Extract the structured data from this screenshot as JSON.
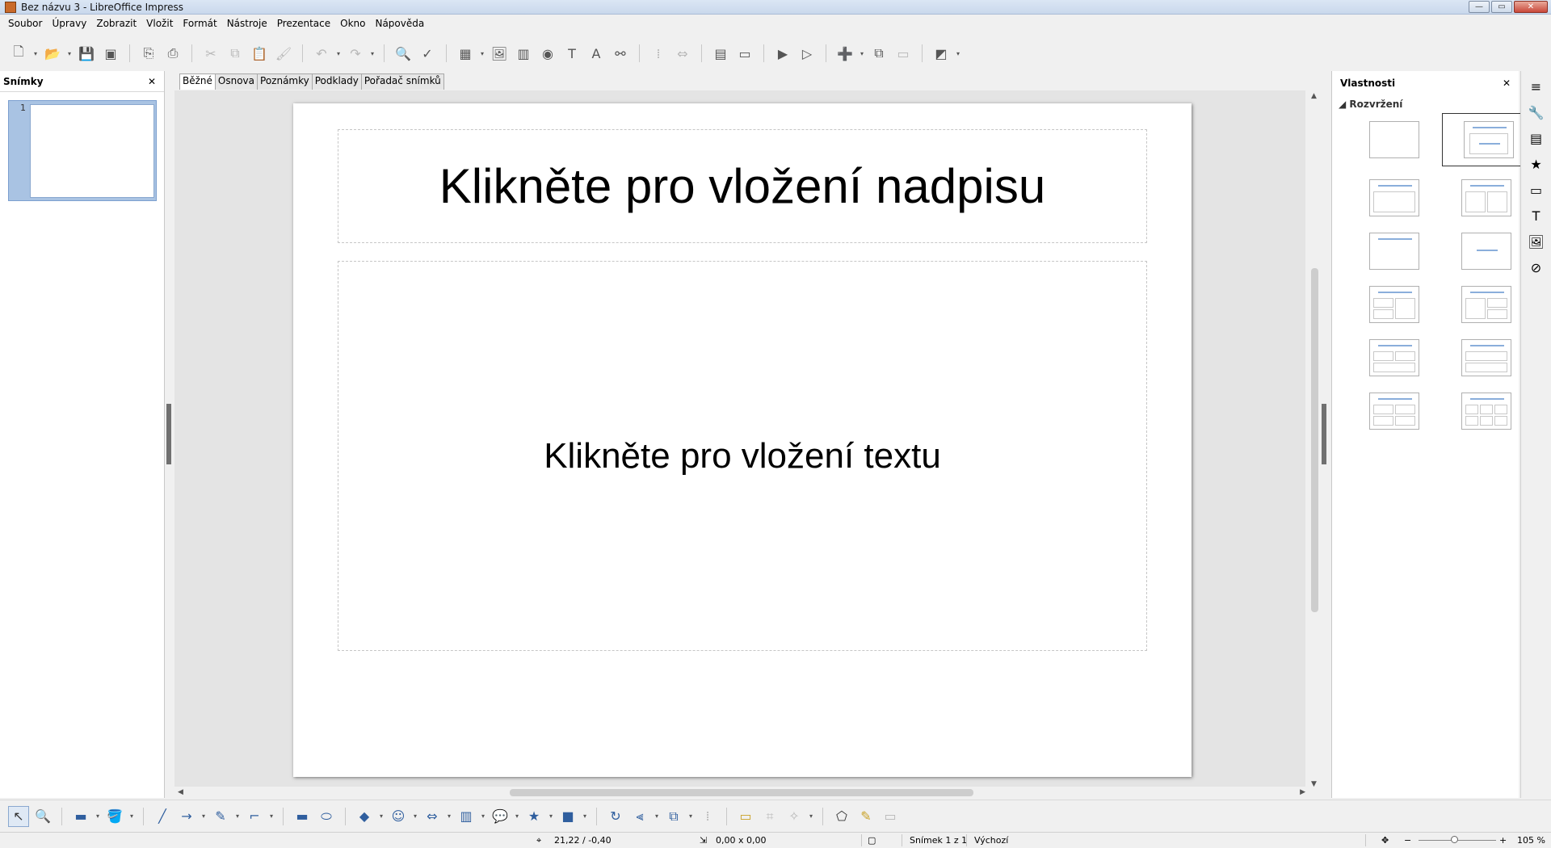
{
  "window": {
    "title": "Bez názvu 3 - LibreOffice Impress",
    "min": "—",
    "max": "▭",
    "close": "✕"
  },
  "menu": [
    "Soubor",
    "Úpravy",
    "Zobrazit",
    "Vložit",
    "Formát",
    "Nástroje",
    "Prezentace",
    "Okno",
    "Nápověda"
  ],
  "slides_pane": {
    "title": "Snímky",
    "close": "✕",
    "slide_number": "1"
  },
  "view_tabs": [
    "Běžné",
    "Osnova",
    "Poznámky",
    "Podklady",
    "Pořadač snímků"
  ],
  "slide": {
    "title_placeholder": "Klikněte pro vložení nadpisu",
    "content_placeholder": "Klikněte pro vložení textu"
  },
  "properties": {
    "title": "Vlastnosti",
    "close": "✕",
    "section": "Rozvržení",
    "section_toggle": "◢"
  },
  "status": {
    "position": "21,22 / -0,40",
    "size": "0,00 x 0,00",
    "slide": "Snímek 1 z 1",
    "master": "Výchozí",
    "zoom": "105 %"
  },
  "colors": {
    "accent": "#8aaedb",
    "selection": "#a9c3e3",
    "workspace": "#e4e4e4"
  }
}
